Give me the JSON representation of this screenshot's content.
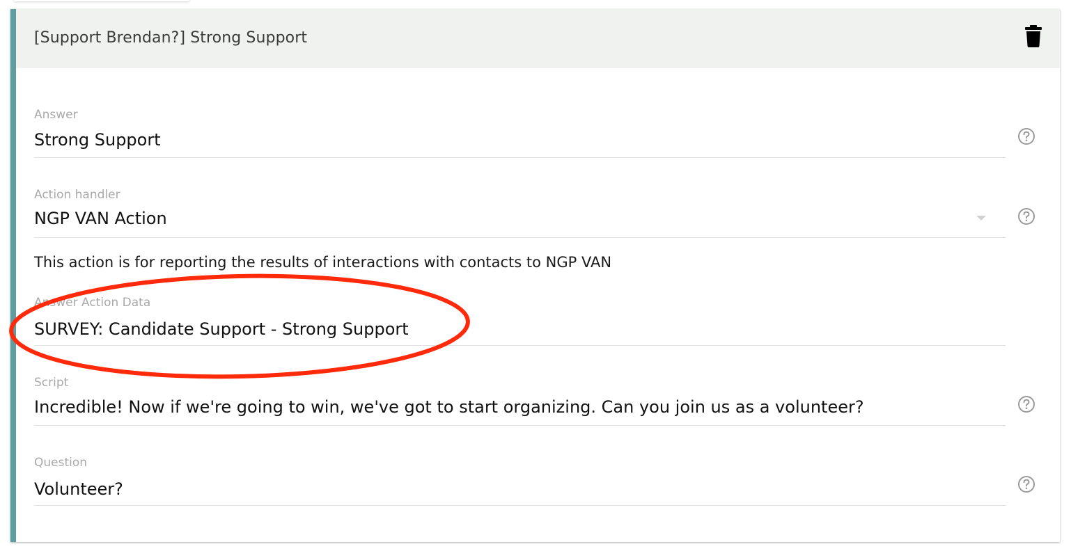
{
  "card": {
    "title": "[Support Brendan?] Strong Support",
    "accent_color": "#5e9ea0",
    "header_background": "#f0f2f0",
    "delete_icon": "trash-icon"
  },
  "fields": {
    "answer": {
      "label": "Answer",
      "value": "Strong Support"
    },
    "action_handler": {
      "label": "Action handler",
      "value": "NGP VAN Action",
      "description": "This action is for reporting the results of interactions with contacts to NGP VAN"
    },
    "answer_action_data": {
      "label": "Answer Action Data",
      "value": "SURVEY: Candidate Support - Strong Support"
    },
    "script": {
      "label": "Script",
      "value": "Incredible! Now if we're going to win, we've got to start organizing. Can you join us as a volunteer?"
    },
    "question": {
      "label": "Question",
      "value": "Volunteer?"
    }
  },
  "icons": {
    "help": "help-circle-icon",
    "dropdown": "chevron-down-icon"
  },
  "annotation": {
    "color": "#ff2a0a"
  }
}
